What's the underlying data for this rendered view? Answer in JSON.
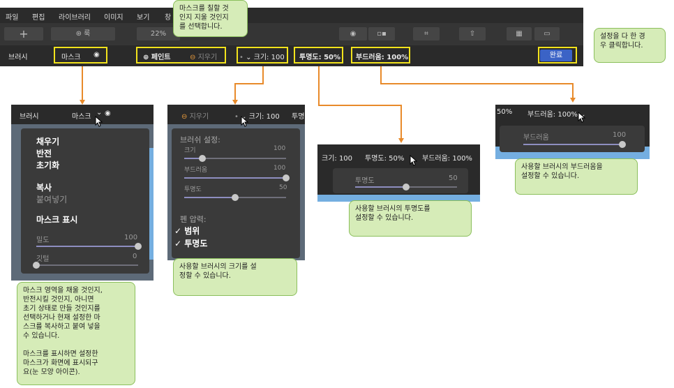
{
  "menu": [
    "파일",
    "편집",
    "라이브러리",
    "이미지",
    "보기",
    "창"
  ],
  "toolbar": {
    "zoom": "22%",
    "look_label": "룩"
  },
  "optbar": {
    "browse": "브러시",
    "mask": "마스크",
    "paint": "페인트",
    "erase": "지우기",
    "size": "크기: 100",
    "opacity": "투명도: 50%",
    "softness": "부드러움: 100%",
    "done": "완료"
  },
  "callouts": {
    "paint_erase": "마스크를 칠할 것\n인지 지울 것인지\n를 선택합니다.",
    "done": "설정을 다 한 경\n우 클릭합니다.",
    "mask": "마스크 영역을 채울 것인지,\n반전시킬 것인지, 아니면\n초기 상태로 만들 것인지를\n선택하거나 현재 설정한 마\n스크를 복사하고 붙여 넣을\n수 있습니다.\n\n마스크를 표시하면 설정한\n마스크가 화면에 표시되구\n요(눈 모양 아이콘).",
    "size": "사용할 브러시의 크기를 설\n정할 수 있습니다.",
    "opacity": "사용할 브러시의 투명도를\n설정할 수 있습니다.",
    "softness": "사용할 브러시의 부드러움을\n설정할 수 있습니다."
  },
  "mask_panel": {
    "header_left": "브러시",
    "header_mask": "마스크",
    "items": [
      "채우기",
      "반전",
      "초기화"
    ],
    "items2": [
      "복사",
      "붙여넣기"
    ],
    "show": "마스크 표시",
    "density_label": "밀도",
    "density_value": "100",
    "feather_label": "깃털",
    "feather_value": "0"
  },
  "brush_panel": {
    "erase": "지우기",
    "size": "크기: 100",
    "opacity_short": "투명",
    "title": "브러쉬 설정:",
    "size_label": "크기",
    "size_value": "100",
    "soft_label": "부드러움",
    "soft_value": "100",
    "opac_label": "투명도",
    "opac_value": "50",
    "pen": "펜 압력:",
    "pen_items": [
      "범위",
      "투명도"
    ]
  },
  "opacity_panel": {
    "size": "크기: 100",
    "opacity": "투명도: 50%",
    "softness": "부드러움: 100%",
    "label": "투명도",
    "value": "50"
  },
  "soft_panel": {
    "opacity": "50%",
    "softness": "부드러움: 100%",
    "label": "부드러움",
    "value": "100"
  },
  "levels": {
    "density": 1.0,
    "feather": 0.0,
    "size": 0.18,
    "soft": 1.0,
    "opac": 0.5,
    "op_panel": 0.5,
    "soft_panel": 1.0
  }
}
